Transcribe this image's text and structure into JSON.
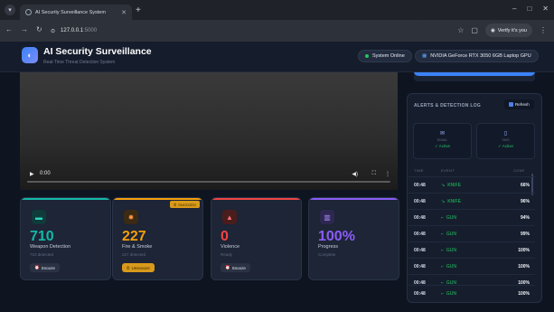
{
  "browser": {
    "tab_title": "AI Security Surveillance System",
    "url_host": "127.0.0.1",
    "url_port": ":5000",
    "profile_label": "Verify it's you"
  },
  "header": {
    "title": "AI Security Surveillance",
    "subtitle": "Real-Time Threat Detection System",
    "status": "System Online",
    "gpu": "NVIDIA GeForce RTX 3050 6GB Laptop GPU"
  },
  "video": {
    "time": "0:00",
    "progress": 0
  },
  "cards": [
    {
      "value": "710",
      "label": "Weapon Detection",
      "sub": "710 detected",
      "button": "Snooze",
      "accent": "#14b8a6",
      "value_color": "#14b8a6"
    },
    {
      "value": "227",
      "label": "Fire & Smoke",
      "sub": "227 detected",
      "button": "Unsnooze",
      "badge": "SNOOZED",
      "accent": "#f59e0b",
      "value_color": "#f59e0b"
    },
    {
      "value": "0",
      "label": "Violence",
      "sub": "Ready",
      "button": "Snooze",
      "accent": "#ef4444",
      "value_color": "#ef4444"
    },
    {
      "value": "100%",
      "label": "Progress",
      "sub": "Complete",
      "accent": "#8b5cf6",
      "value_color": "#8b5cf6"
    }
  ],
  "alerts": {
    "title": "ALERTS & DETECTION LOG",
    "refresh": "Refresh",
    "stats": [
      {
        "label": "EMAIL",
        "status": "✓ Active"
      },
      {
        "label": "SMS",
        "status": "✓ Active"
      }
    ],
    "columns": {
      "time": "TIME",
      "event": "EVENT",
      "conf": "CONF."
    },
    "rows": [
      {
        "time": "00:48",
        "event": "KNIFE",
        "conf": "66%"
      },
      {
        "time": "00:48",
        "event": "KNIFE",
        "conf": "96%"
      },
      {
        "time": "00:48",
        "event": "GUN",
        "conf": "94%"
      },
      {
        "time": "00:48",
        "event": "GUN",
        "conf": "99%"
      },
      {
        "time": "00:48",
        "event": "GUN",
        "conf": "100%"
      },
      {
        "time": "00:48",
        "event": "GUN",
        "conf": "100%"
      },
      {
        "time": "00:48",
        "event": "GUN",
        "conf": "100%"
      },
      {
        "time": "00:48",
        "event": "GUN",
        "conf": "100%"
      }
    ]
  }
}
